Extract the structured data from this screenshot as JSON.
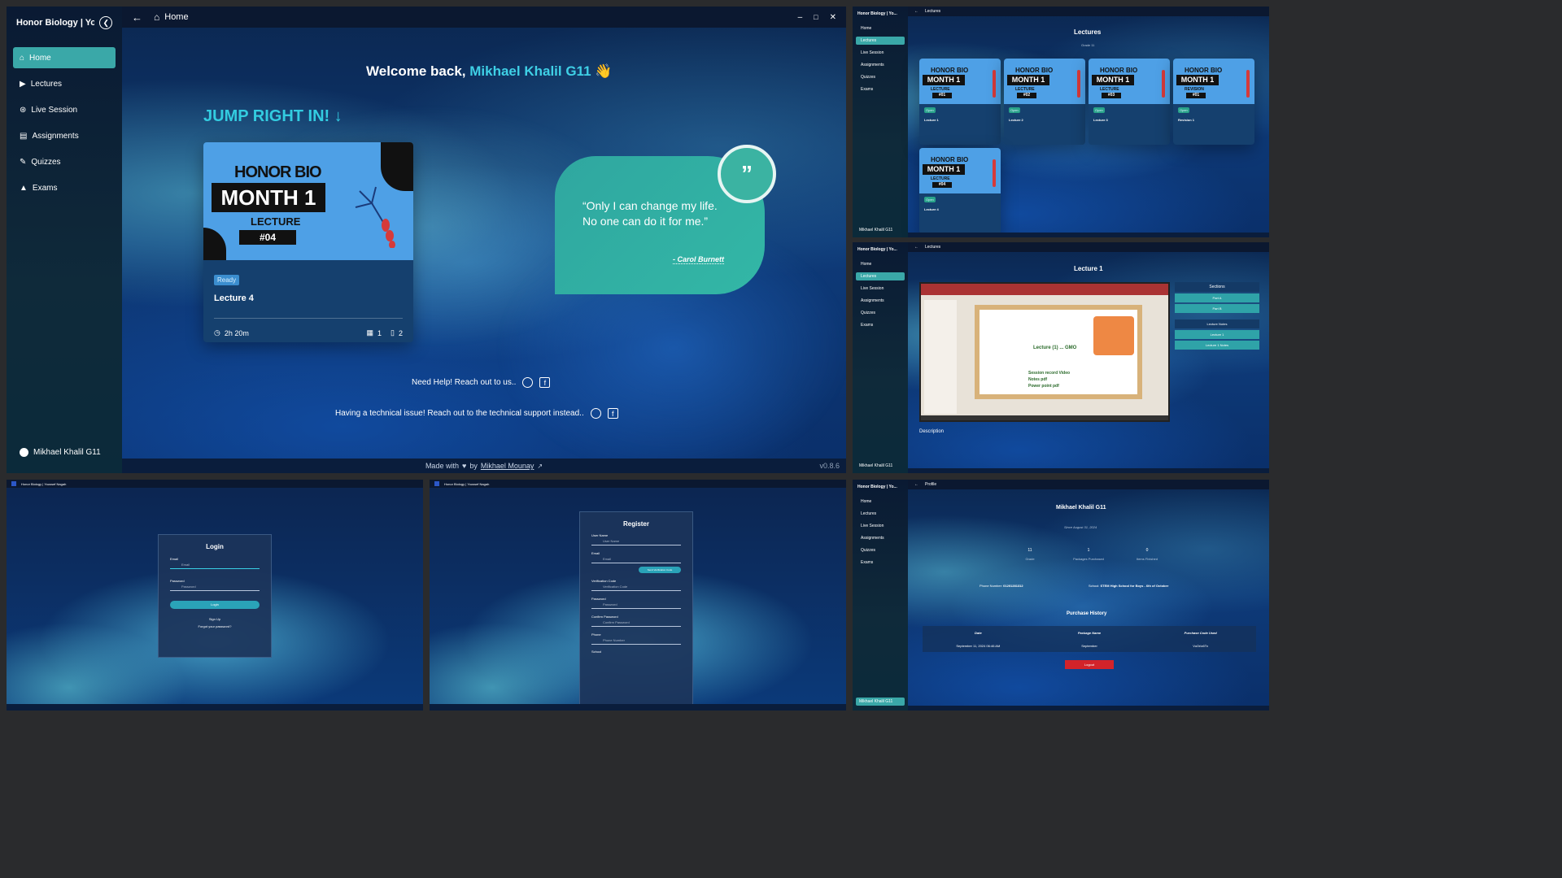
{
  "app": {
    "title": "Honor Biology | Yo...",
    "full_title": "Honor Biology | Youssef Nagah",
    "version": "v0.8.6"
  },
  "sidebar": {
    "items": [
      {
        "label": "Home"
      },
      {
        "label": "Lectures"
      },
      {
        "label": "Live Session"
      },
      {
        "label": "Assignments"
      },
      {
        "label": "Quizzes"
      },
      {
        "label": "Exams"
      }
    ],
    "user": "Mikhael Khalil G11"
  },
  "home": {
    "tab": "Home",
    "welcome": "Welcome back, ",
    "user": "Mikhael Khalil G11",
    "wave": "👋",
    "jump": "JUMP RIGHT IN!",
    "card": {
      "thumb_top": "HONOR BIO",
      "thumb_month": "MONTH 1",
      "thumb_lecture": "LECTURE",
      "thumb_num": "#04",
      "status": "Ready",
      "title": "Lecture 4",
      "duration": "2h 20m",
      "sections": "1",
      "files": "2"
    },
    "quote": {
      "text": "Only I can change my life. No one can do it for me.",
      "author": "- Carol Burnett"
    },
    "help": "Need Help! Reach out to us..",
    "tech": "Having a technical issue! Reach out to the technical support instead..",
    "footer_made": "Made with",
    "footer_by": "by",
    "footer_author": "Mikhael Mounay"
  },
  "lectures": {
    "tab": "Lectures",
    "title": "Lectures",
    "subtitle": "Grade 11",
    "cards": [
      {
        "num": "#01",
        "title": "Lecture 1",
        "kind": "LECTURE"
      },
      {
        "num": "#02",
        "title": "Lecture 2",
        "kind": "LECTURE"
      },
      {
        "num": "#03",
        "title": "Lecture 3",
        "kind": "LECTURE"
      },
      {
        "num": "#01",
        "title": "Revision 1",
        "kind": "REVISION"
      },
      {
        "num": "#04",
        "title": "Lecture 4",
        "kind": "LECTURE"
      }
    ],
    "card_top": "HONOR BIO",
    "card_month": "MONTH 1",
    "card_status": "Open"
  },
  "lecture_view": {
    "tab": "Lectures",
    "title": "Lecture 1",
    "sections_title": "Sections",
    "parts": [
      "Part A",
      "Part B"
    ],
    "items": [
      "Lecture Notes",
      "Lecture 1",
      "Lecture 1 Notes"
    ],
    "description": "Description",
    "slide_title": "Lecture (1) ... GMO",
    "slide_links": [
      "Session record Video",
      "Notes pdf",
      "Power point pdf"
    ]
  },
  "login": {
    "title": "Login",
    "email_label": "Email",
    "email_ph": "Email",
    "password_label": "Password",
    "password_ph": "Password",
    "button": "Login",
    "signup": "Sign Up",
    "forgot": "Forgot your password?"
  },
  "register": {
    "title": "Register",
    "fields": [
      {
        "label": "User Name",
        "ph": "User Name"
      },
      {
        "label": "Email",
        "ph": "Email"
      },
      {
        "label": "Verification Code",
        "ph": "Verification Code"
      },
      {
        "label": "Password",
        "ph": "Password"
      },
      {
        "label": "Confirm Password",
        "ph": "Confirm Password"
      },
      {
        "label": "Phone",
        "ph": "Phone Number"
      }
    ],
    "send_code": "Send Verification Code",
    "school": "School"
  },
  "profile": {
    "tab": "Profile",
    "name": "Mikhael Khalil G11",
    "since": "Since August 31, 2024",
    "stats": [
      {
        "value": "11",
        "label": "Grade"
      },
      {
        "value": "1",
        "label": "Packages Purchased"
      },
      {
        "value": "0",
        "label": "Items Finished"
      }
    ],
    "phone_label": "Phone Number:",
    "phone": "01201281312",
    "school_label": "School:",
    "school": "STEM High School for Boys - 6th of October",
    "history_title": "Purchase History",
    "headers": [
      "Date",
      "Package Name",
      "Purchase Code Used"
    ],
    "row": [
      "September 11, 2024 06:46 AM",
      "September",
      "VuOrIz6Tx"
    ],
    "logout": "Logout"
  }
}
